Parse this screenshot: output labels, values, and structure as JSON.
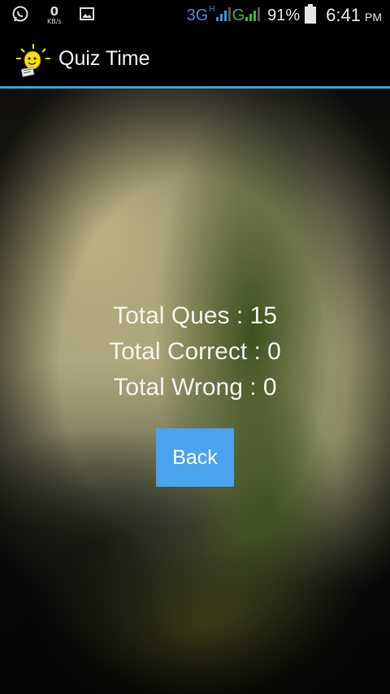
{
  "status_bar": {
    "netspeed_value": "0",
    "netspeed_unit": "KB/s",
    "network_3g": "3G",
    "network_h": "H",
    "network_g": "G",
    "battery_percent": "91%",
    "time": "6:41",
    "ampm": "PM",
    "icons": [
      "whatsapp-icon",
      "image-notification-icon",
      "signal-icon",
      "battery-icon"
    ]
  },
  "action_bar": {
    "title": "Quiz Time",
    "logo_icon": "lightbulb-icon"
  },
  "results": {
    "total_ques": "Total Ques : 15",
    "total_correct": "Total Correct : 0",
    "total_wrong": "Total Wrong : 0"
  },
  "back_button": {
    "label": "Back"
  },
  "colors": {
    "accent_divider": "#33a6dc",
    "button": "#4aa3ee",
    "network_3g": "#3d8fd4",
    "network_g": "#37b24d"
  }
}
